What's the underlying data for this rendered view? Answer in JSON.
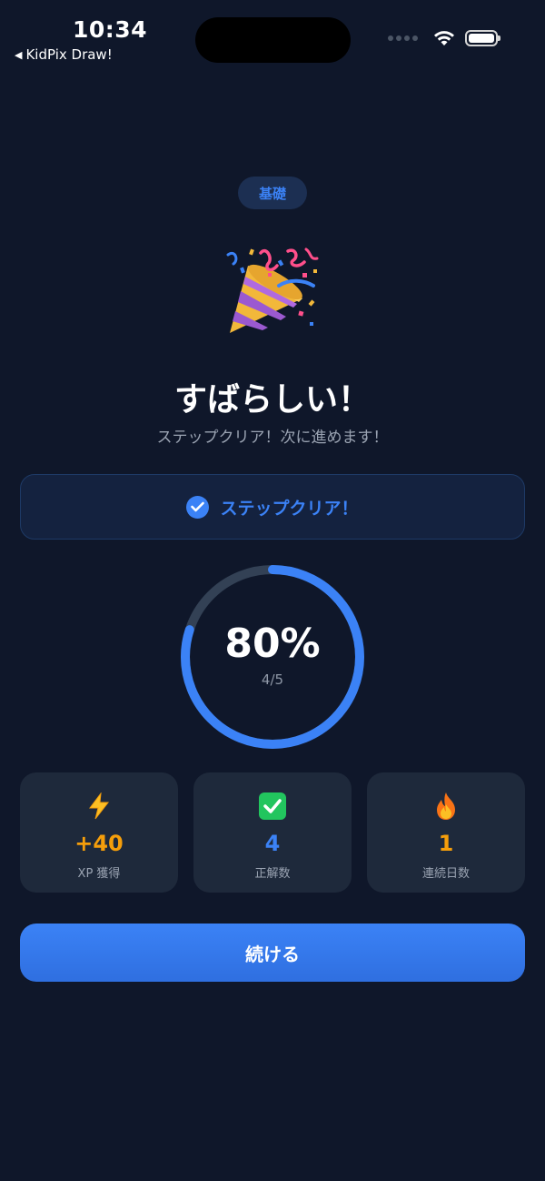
{
  "status_bar": {
    "time": "10:34",
    "back_label": "KidPix Draw!"
  },
  "category_pill": "基礎",
  "headline": "すばらしい！",
  "subline": "ステップクリア！次に進めます！",
  "clear_banner": {
    "text": "ステップクリア！"
  },
  "progress": {
    "percent_label": "80%",
    "fraction_label": "4/5",
    "value": 0.8
  },
  "stats": [
    {
      "icon": "lightning-icon",
      "value": "+40",
      "label": "XP 獲得",
      "color": "#f59e0b"
    },
    {
      "icon": "check-mark-icon",
      "value": "4",
      "label": "正解数",
      "color": "#3b82f6"
    },
    {
      "icon": "fire-icon",
      "value": "1",
      "label": "連続日数",
      "color": "#f59e0b"
    }
  ],
  "continue_button": "続ける",
  "colors": {
    "background": "#0f172a",
    "accent": "#3b82f6",
    "card": "#1e293b",
    "ring_track": "#334155"
  }
}
